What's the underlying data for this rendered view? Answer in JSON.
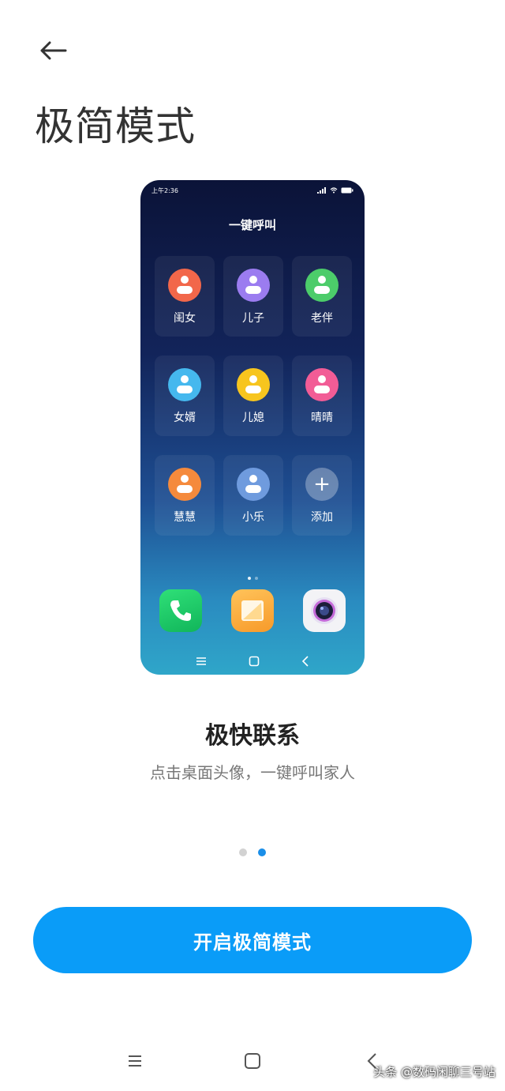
{
  "header": {
    "title": "极简模式"
  },
  "preview": {
    "status_time": "上午2:36",
    "heading": "一键呼叫",
    "contacts": [
      {
        "label": "闺女",
        "color": "#f2674a"
      },
      {
        "label": "儿子",
        "color": "#9b7cf0"
      },
      {
        "label": "老伴",
        "color": "#4ccc6a"
      },
      {
        "label": "女婿",
        "color": "#45b8ee"
      },
      {
        "label": "儿媳",
        "color": "#f7c51e"
      },
      {
        "label": "晴晴",
        "color": "#f25c96"
      },
      {
        "label": "慧慧",
        "color": "#f58a3c"
      },
      {
        "label": "小乐",
        "color": "#6f9bde"
      }
    ],
    "add_label": "添加"
  },
  "feature": {
    "title": "极快联系",
    "description": "点击桌面头像，一键呼叫家人"
  },
  "pagination": {
    "total": 2,
    "active_index": 1
  },
  "cta": {
    "label": "开启极简模式"
  },
  "watermark": "头条 @数码闲聊三号站",
  "colors": {
    "accent": "#0a9cf8",
    "dot_active": "#1a8ee8"
  }
}
